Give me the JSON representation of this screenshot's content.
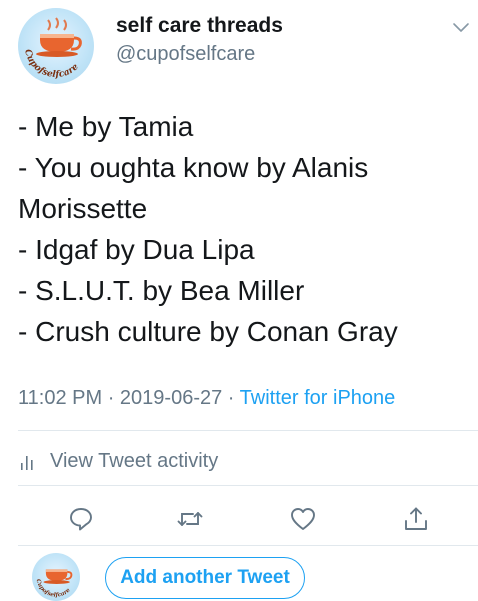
{
  "author": {
    "display_name": "self care threads",
    "handle": "@cupofselfcare",
    "avatar_text": "Cupofselfcare"
  },
  "tweet": {
    "lines": [
      "- Me by Tamia",
      "- You oughta know by Alanis",
      "Morissette",
      "- Idgaf by Dua Lipa",
      "- S.L.U.T. by Bea Miller",
      "- Crush culture by Conan Gray"
    ],
    "time": "11:02 PM",
    "separator": "·",
    "date": "2019-06-27",
    "source": "Twitter for iPhone"
  },
  "activity": {
    "label": "View Tweet activity"
  },
  "actions": [
    "reply-icon",
    "retweet-icon",
    "like-icon",
    "share-icon"
  ],
  "reply_bar": {
    "button_label": "Add another Tweet"
  },
  "colors": {
    "accent": "#1da1f2",
    "secondary_text": "#657786",
    "divider": "#e1e8ed"
  }
}
